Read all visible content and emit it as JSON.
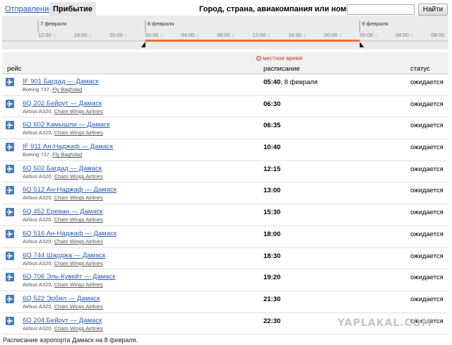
{
  "tabs": {
    "departure": "Отправление",
    "arrival": "Прибытие"
  },
  "search": {
    "label": "Город, страна, авиакомпания или номер рейса",
    "value": "",
    "button": "Найти"
  },
  "timeline": {
    "dates": [
      "7 февраля",
      "8 февраля",
      "9 февраля"
    ],
    "ticks": [
      "12:00",
      "16:00",
      "20:00",
      "00:00",
      "04:00",
      "08:00",
      "12:00",
      "16:00",
      "20:00",
      "00:00",
      "04:00",
      "08:00"
    ],
    "accent": "#e8733a"
  },
  "table": {
    "local_time": "местное время",
    "col_flight": "рейс",
    "col_schedule": "расписание",
    "col_status": "статус"
  },
  "flights": [
    {
      "flight": "IF 901 Багдад — Дамаск",
      "aircraft": "Boeing 737, ",
      "airline": "Fly Baghdad",
      "time": "05:40",
      "date": ", 8 февраля",
      "status": "ожидается"
    },
    {
      "flight": "6Q 202 Бейрут — Дамаск",
      "aircraft": "Airbus A320, ",
      "airline": "Cham Wings Airlines",
      "time": "06:30",
      "date": "",
      "status": "ожидается"
    },
    {
      "flight": "6Q 602 Камышли — Дамаск",
      "aircraft": "Airbus A320, ",
      "airline": "Cham Wings Airlines",
      "time": "06:35",
      "date": "",
      "status": "ожидается"
    },
    {
      "flight": "IF 911 Ан-Наджаф — Дамаск",
      "aircraft": "Boeing 737, ",
      "airline": "Fly Baghdad",
      "time": "10:40",
      "date": "",
      "status": "ожидается"
    },
    {
      "flight": "6Q 502 Багдад — Дамаск",
      "aircraft": "Airbus A320, ",
      "airline": "Cham Wings Airlines",
      "time": "12:15",
      "date": "",
      "status": "ожидается"
    },
    {
      "flight": "6Q 512 Ан-Наджаф — Дамаск",
      "aircraft": "Airbus A320, ",
      "airline": "Cham Wings Airlines",
      "time": "13:00",
      "date": "",
      "status": "ожидается"
    },
    {
      "flight": "6Q 452 Ереван — Дамаск",
      "aircraft": "Airbus A320, ",
      "airline": "Cham Wings Airlines",
      "time": "15:30",
      "date": "",
      "status": "ожидается"
    },
    {
      "flight": "6Q 516 Ан-Наджаф — Дамаск",
      "aircraft": "Airbus A320, ",
      "airline": "Cham Wings Airlines",
      "time": "18:00",
      "date": "",
      "status": "ожидается"
    },
    {
      "flight": "6Q 744 Шарджа — Дамаск",
      "aircraft": "Airbus A320, ",
      "airline": "Cham Wings Airlines",
      "time": "18:30",
      "date": "",
      "status": "ожидается"
    },
    {
      "flight": "6Q 706 Эль-Кувейт — Дамаск",
      "aircraft": "Airbus A320, ",
      "airline": "Cham Wings Airlines",
      "time": "19:20",
      "date": "",
      "status": "ожидается"
    },
    {
      "flight": "6Q 522 Эрбил — Дамаск",
      "aircraft": "Airbus A320, ",
      "airline": "Cham Wings Airlines",
      "time": "21:30",
      "date": "",
      "status": "ожидается"
    },
    {
      "flight": "6Q 204 Бейрут — Дамаск",
      "aircraft": "Airbus A320, ",
      "airline": "Cham Wings Airlines",
      "time": "22:30",
      "date": "",
      "status": "ожидается"
    }
  ],
  "watermark": "YAPLAKAL.COM",
  "footer": "Расписание аэропорта Дамаск на 8 февраля."
}
